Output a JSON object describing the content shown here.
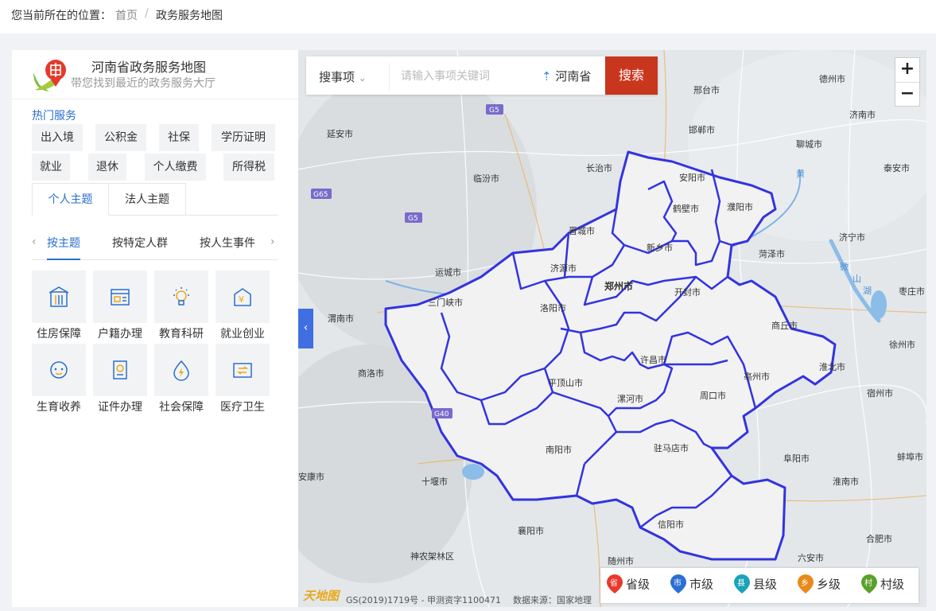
{
  "breadcrumb": {
    "prefix": "您当前所在的位置：",
    "home": "首页",
    "separator": "/",
    "current": "政务服务地图"
  },
  "app": {
    "title": "河南省政务服务地图",
    "subtitle": "带您找到最近的政务服务大厅"
  },
  "hot": {
    "title": "热门服务",
    "tags": [
      "出入境",
      "公积金",
      "社保",
      "学历证明",
      "就业",
      "退休",
      "个人缴费",
      "所得税"
    ]
  },
  "tabs": [
    "个人主题",
    "法人主题"
  ],
  "subtabs": [
    "按主题",
    "按特定人群",
    "按人生事件"
  ],
  "services": [
    "住房保障",
    "户籍办理",
    "教育科研",
    "就业创业",
    "生育收养",
    "证件办理",
    "社会保障",
    "医疗卫生"
  ],
  "search": {
    "category": "搜事项",
    "placeholder": "请输入事项关键词",
    "region": "河南省",
    "button": "搜索"
  },
  "zoom": {
    "in": "+",
    "out": "−"
  },
  "legend": [
    {
      "badge": "省",
      "label": "省级",
      "color": "#e8392c"
    },
    {
      "badge": "市",
      "label": "市级",
      "color": "#2b6fd6"
    },
    {
      "badge": "县",
      "label": "县级",
      "color": "#1aa3b8"
    },
    {
      "badge": "乡",
      "label": "乡级",
      "color": "#e8891c"
    },
    {
      "badge": "村",
      "label": "村级",
      "color": "#5aa02c"
    }
  ],
  "map": {
    "cities": [
      "德州市",
      "邢台市",
      "济南市",
      "邯郸市",
      "延安市",
      "聊城市",
      "泰安市",
      "临汾市",
      "长治市",
      "安阳市",
      "鹤壁市",
      "濮阳市",
      "晋城市",
      "济宁市",
      "新乡市",
      "菏泽市",
      "运城市",
      "济源市",
      "郑州市",
      "开封市",
      "枣庄市",
      "三门峡市",
      "洛阳市",
      "渭南市",
      "商丘市",
      "许昌市",
      "徐州市",
      "商洛市",
      "淮北市",
      "平顶山市",
      "亳州市",
      "漯河市",
      "周口市",
      "宿州市",
      "南阳市",
      "驻马店市",
      "阜阳市",
      "蚌埠市",
      "十堰市",
      "淮南市",
      "信阳市",
      "襄阳市",
      "合肥市",
      "神农架林区",
      "随州市",
      "六安市",
      "安康市"
    ],
    "highways": [
      "G5",
      "G65",
      "G5",
      "G40"
    ],
    "water": [
      "黄",
      "微",
      "山",
      "湖"
    ],
    "copyright": "GS(2019)1719号 - 甲测资字1100471",
    "source": "数据来源：国家地理",
    "logo_text": "天地图"
  }
}
